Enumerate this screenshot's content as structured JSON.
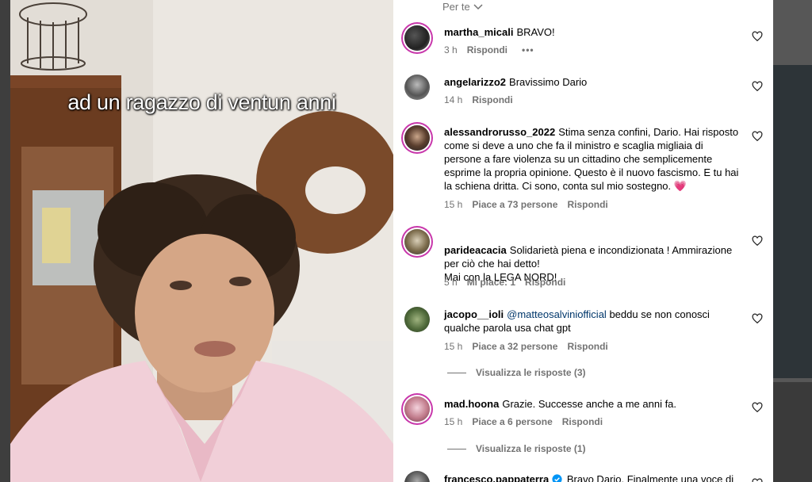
{
  "video": {
    "caption": "ad un ragazzo di ventun anni"
  },
  "panel": {
    "feed_selector": "Per te",
    "comments": [
      {
        "username": "martha_micali",
        "text": "BRAVO!",
        "time": "3 h",
        "likes": "",
        "reply": "Rispondi",
        "more": "•••",
        "replies": ""
      },
      {
        "username": "angelarizzo2",
        "text": "Bravissimo Dario",
        "time": "14 h",
        "likes": "",
        "reply": "Rispondi",
        "more": "",
        "replies": ""
      },
      {
        "username": "alessandrorusso_2022",
        "text": "Stima senza confini, Dario. Hai risposto come si deve a uno che fa il ministro e scaglia migliaia di persone a fare violenza su un cittadino che semplicemente esprime la propria opinione. Questo è il nuovo fascismo. E tu hai la schiena dritta. Ci sono, conta sul mio sostegno. 💗",
        "time": "15 h",
        "likes": "Piace a 73 persone",
        "reply": "Rispondi",
        "more": "",
        "replies": ""
      },
      {
        "username": "parideacacia",
        "text": "Solidarietà piena e incondizionata ! Ammirazione per ciò che hai detto!\nMai con la LEGA NORD!",
        "time": "5 h",
        "likes": "Mi piace: 1",
        "reply": "Rispondi",
        "more": "",
        "replies": ""
      },
      {
        "username": "jacopo__ioli",
        "mention": "@matteosalviniofficial",
        "text": "beddu se non conosci qualche parola usa chat gpt",
        "time": "15 h",
        "likes": "Piace a 32 persone",
        "reply": "Rispondi",
        "more": "",
        "replies": "Visualizza le risposte (3)"
      },
      {
        "username": "mad.hoona",
        "text": "Grazie. Successe anche a me anni fa.",
        "time": "15 h",
        "likes": "Piace a 6 persone",
        "reply": "Rispondi",
        "more": "",
        "replies": "Visualizza le risposte (1)"
      },
      {
        "username": "francesco.pappaterra",
        "text": "Bravo Dario. Finalmente una voce di",
        "time": "",
        "likes": "",
        "reply": "",
        "more": "",
        "replies": ""
      }
    ]
  },
  "colors": {
    "story_ring": "#c837ab",
    "secondary_text": "#737373",
    "mention": "#00376b",
    "verified": "#0095f6"
  }
}
